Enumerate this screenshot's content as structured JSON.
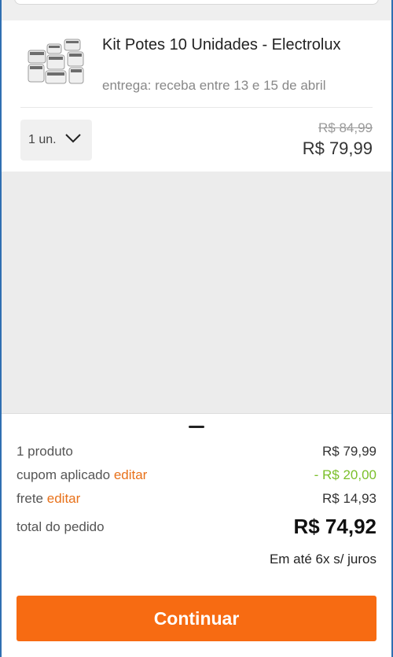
{
  "product": {
    "name": "Kit Potes 10 Unidades - Electrolux",
    "delivery": "entrega: receba entre 13 e 15 de abril",
    "quantity": "1 un.",
    "old_price": "R$ 84,99",
    "price": "R$ 79,99",
    "image_icon": "food-containers-set"
  },
  "summary": {
    "products_label": "1 produto",
    "products_value": "R$ 79,99",
    "coupon_label": "cupom aplicado",
    "coupon_edit": "editar",
    "coupon_value": "- R$ 20,00",
    "shipping_label": "frete",
    "shipping_edit": "editar",
    "shipping_value": "R$ 14,93",
    "total_label": "total do pedido",
    "total_value": "R$ 74,92",
    "installments": "Em até 6x s/ juros",
    "continue_label": "Continuar"
  },
  "colors": {
    "accent": "#f76b12",
    "discount": "#7bbf2a",
    "edit_link": "#e8711a"
  }
}
